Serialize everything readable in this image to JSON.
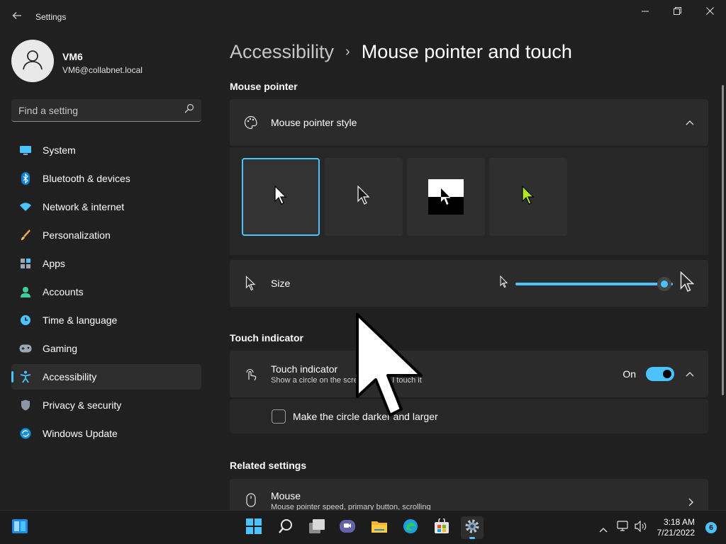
{
  "window": {
    "app_title": "Settings",
    "icons": {
      "back": "back-arrow-icon",
      "minimize": "minimize-icon",
      "restore": "restore-icon",
      "close": "close-icon"
    }
  },
  "profile": {
    "name": "VM6",
    "email": "VM6@collabnet.local",
    "avatar_icon": "user-avatar-icon"
  },
  "search": {
    "placeholder": "Find a setting",
    "icon": "search-icon"
  },
  "sidebar": {
    "items": [
      {
        "label": "System",
        "icon": "system-monitor-icon",
        "active": false
      },
      {
        "label": "Bluetooth & devices",
        "icon": "bluetooth-icon",
        "active": false
      },
      {
        "label": "Network & internet",
        "icon": "wifi-icon",
        "active": false
      },
      {
        "label": "Personalization",
        "icon": "brush-icon",
        "active": false
      },
      {
        "label": "Apps",
        "icon": "apps-icon",
        "active": false
      },
      {
        "label": "Accounts",
        "icon": "accounts-icon",
        "active": false
      },
      {
        "label": "Time & language",
        "icon": "clock-globe-icon",
        "active": false
      },
      {
        "label": "Gaming",
        "icon": "gamepad-icon",
        "active": false
      },
      {
        "label": "Accessibility",
        "icon": "accessibility-icon",
        "active": true
      },
      {
        "label": "Privacy & security",
        "icon": "shield-icon",
        "active": false
      },
      {
        "label": "Windows Update",
        "icon": "update-icon",
        "active": false
      }
    ]
  },
  "breadcrumb": {
    "parent": "Accessibility",
    "separator": "›",
    "current": "Mouse pointer and touch"
  },
  "mouse_pointer": {
    "section_title": "Mouse pointer",
    "style_label": "Mouse pointer style",
    "styles": [
      {
        "name": "white",
        "selected": true
      },
      {
        "name": "black",
        "selected": false
      },
      {
        "name": "inverted",
        "selected": false
      },
      {
        "name": "custom",
        "selected": false,
        "color": "#b5e61d"
      }
    ],
    "size_label": "Size",
    "size_value": 1.0
  },
  "touch_indicator": {
    "section_title": "Touch indicator",
    "label": "Touch indicator",
    "description": "Show a circle on the screen where I touch it",
    "toggle_state": "On",
    "checkbox_label": "Make the circle darker and larger",
    "checkbox_checked": false
  },
  "related": {
    "section_title": "Related settings",
    "mouse_label": "Mouse",
    "mouse_description": "Mouse pointer speed, primary button, scrolling"
  },
  "taskbar": {
    "icons": [
      "widgets-icon",
      "start-icon",
      "search-icon",
      "task-view-icon",
      "teams-chat-icon",
      "file-explorer-icon",
      "edge-icon",
      "store-icon",
      "settings-icon"
    ],
    "time": "3:18 AM",
    "date": "7/21/2022",
    "notification_count": "6"
  },
  "colors": {
    "accent": "#4cc2ff",
    "background": "#202020",
    "card": "#2b2b2b"
  }
}
